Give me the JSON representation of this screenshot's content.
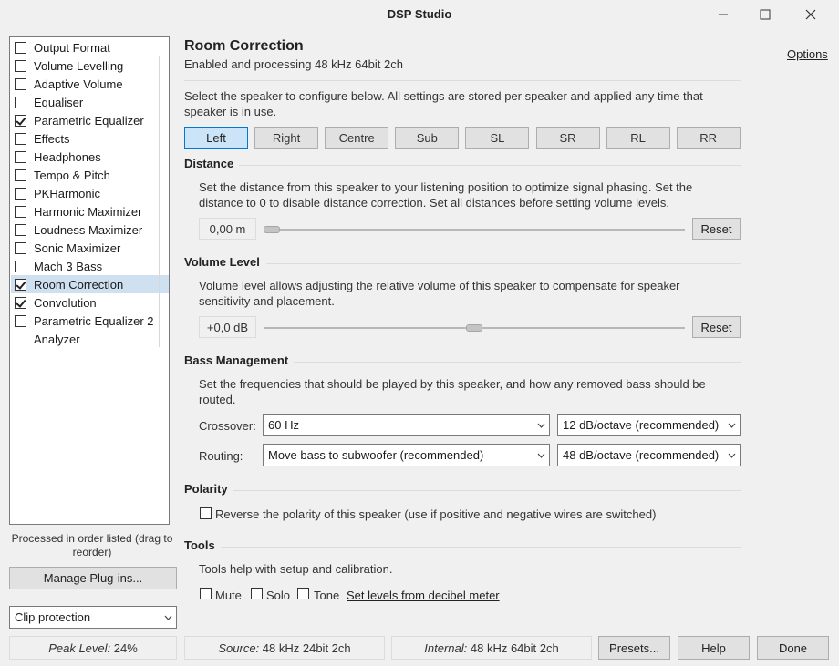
{
  "window": {
    "title": "DSP Studio"
  },
  "sidebar": {
    "items": [
      {
        "label": "Output Format",
        "checked": false
      },
      {
        "label": "Volume Levelling",
        "checked": false
      },
      {
        "label": "Adaptive Volume",
        "checked": false
      },
      {
        "label": "Equaliser",
        "checked": false
      },
      {
        "label": "Parametric Equalizer",
        "checked": true
      },
      {
        "label": "Effects",
        "checked": false
      },
      {
        "label": "Headphones",
        "checked": false
      },
      {
        "label": "Tempo & Pitch",
        "checked": false
      },
      {
        "label": "PKHarmonic",
        "checked": false
      },
      {
        "label": "Harmonic Maximizer",
        "checked": false
      },
      {
        "label": "Loudness Maximizer",
        "checked": false
      },
      {
        "label": "Sonic Maximizer",
        "checked": false
      },
      {
        "label": "Mach 3 Bass",
        "checked": false
      },
      {
        "label": "Room Correction",
        "checked": true,
        "selected": true
      },
      {
        "label": "Convolution",
        "checked": true
      },
      {
        "label": "Parametric Equalizer 2",
        "checked": false
      },
      {
        "label": "Analyzer",
        "checked": null
      }
    ],
    "processed_note": "Processed in order listed (drag to reorder)",
    "manage_label": "Manage Plug-ins...",
    "clip_value": "Clip protection"
  },
  "status": {
    "peak_label": "Peak Level:",
    "peak_value": "24%",
    "source_label": "Source:",
    "source_value": "48 kHz 24bit 2ch",
    "internal_label": "Internal:",
    "internal_value": "48 kHz 64bit 2ch"
  },
  "footer": {
    "presets": "Presets...",
    "help": "Help",
    "done": "Done"
  },
  "main": {
    "title": "Room Correction",
    "subtitle": "Enabled and processing 48 kHz 64bit 2ch",
    "options": "Options",
    "intro_1": "Select the speaker to configure below.  All settings are stored per speaker and applied any time that",
    "intro_2": "speaker is in use.",
    "speakers": [
      "Left",
      "Right",
      "Centre",
      "Sub",
      "SL",
      "SR",
      "RL",
      "RR"
    ],
    "active_speaker": "Left",
    "distance": {
      "heading": "Distance",
      "desc_1": "Set the distance from this speaker to your listening position to optimize signal phasing.  Set the",
      "desc_2": "distance to 0 to disable distance correction.  Set all distances before setting volume levels.",
      "value": "0,00 m",
      "level": 0.0,
      "reset": "Reset"
    },
    "volume": {
      "heading": "Volume Level",
      "desc_1": "Volume level allows adjusting the relative volume of this speaker to compensate for speaker",
      "desc_2": "sensitivity and placement.",
      "value": "+0,0 dB",
      "level": 0.5,
      "reset": "Reset"
    },
    "bass": {
      "heading": "Bass Management",
      "desc_1": "Set the frequencies that should be played by this speaker, and how any removed bass should be",
      "desc_2": "routed.",
      "crossover_label": "Crossover:",
      "crossover_value": "60 Hz",
      "crossover_slope": "12 dB/octave (recommended)",
      "routing_label": "Routing:",
      "routing_value": "Move bass to subwoofer (recommended)",
      "routing_slope": "48 dB/octave (recommended)"
    },
    "polarity": {
      "heading": "Polarity",
      "reverse_label": "Reverse the polarity of this speaker (use if positive and negative wires are switched)"
    },
    "tools": {
      "heading": "Tools",
      "desc": "Tools help with setup and calibration.",
      "mute": "Mute",
      "solo": "Solo",
      "tone": "Tone",
      "decibel_link": "Set levels from decibel meter"
    }
  }
}
